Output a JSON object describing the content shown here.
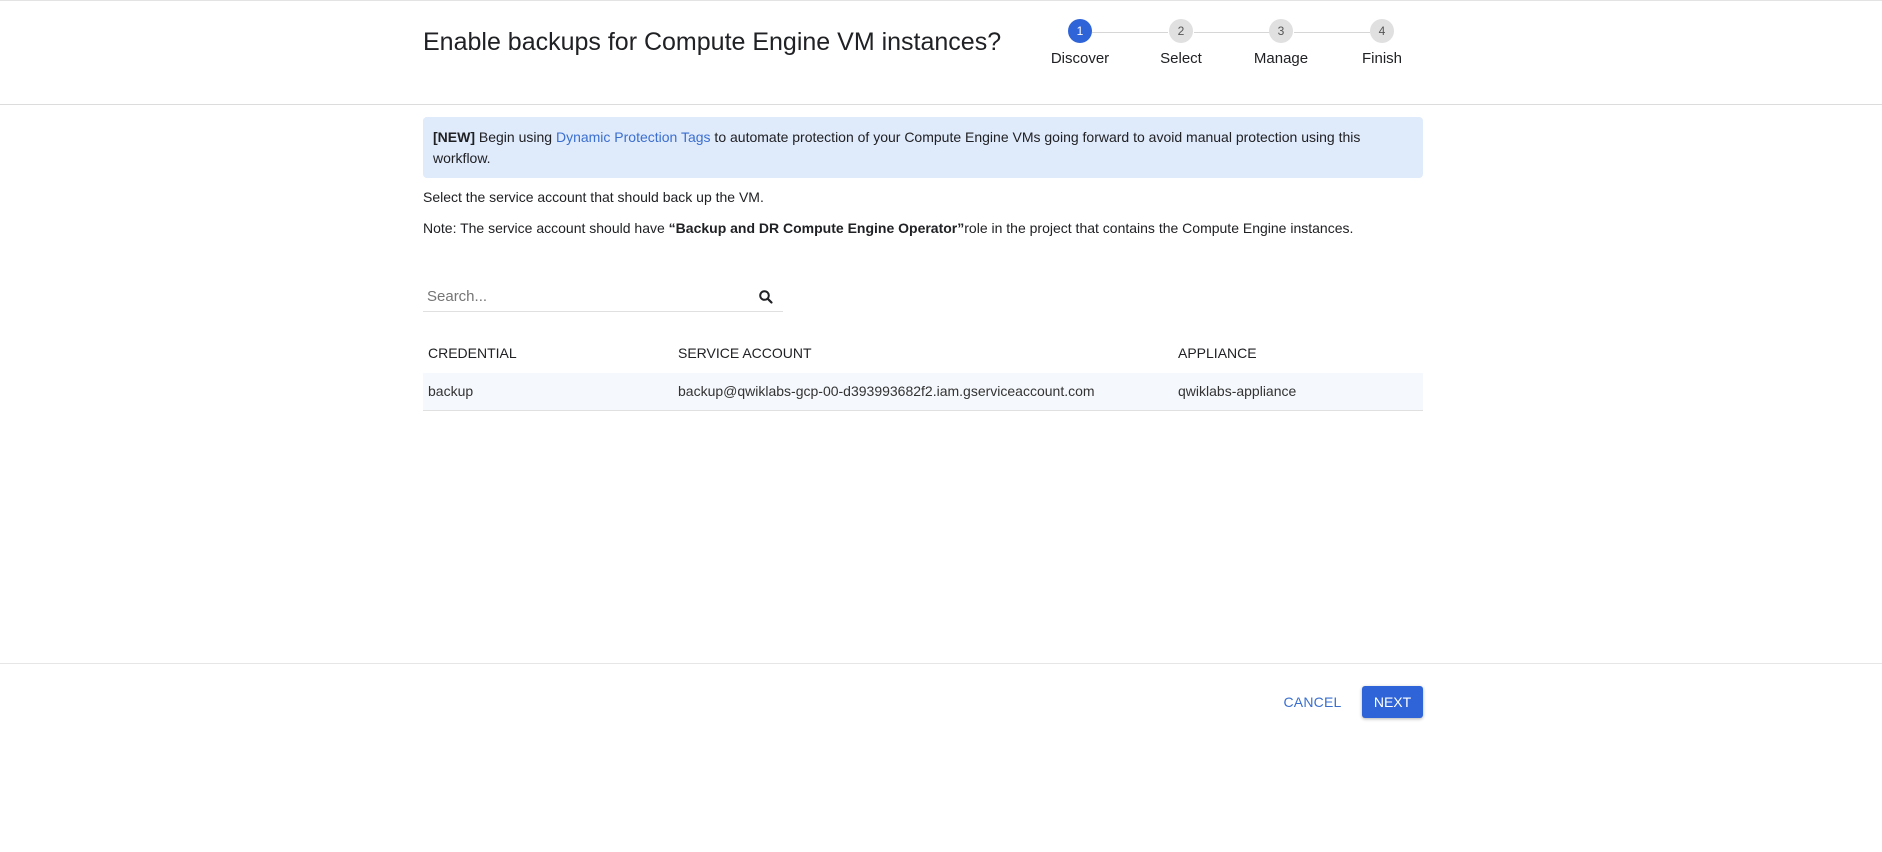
{
  "header": {
    "title": "Enable backups for Compute Engine VM instances?"
  },
  "stepper": {
    "active_step": 1,
    "steps": [
      {
        "number": "1",
        "label": "Discover"
      },
      {
        "number": "2",
        "label": "Select"
      },
      {
        "number": "3",
        "label": "Manage"
      },
      {
        "number": "4",
        "label": "Finish"
      }
    ]
  },
  "banner": {
    "tag": "[NEW]",
    "text_before": " Begin using ",
    "link": "Dynamic Protection Tags",
    "text_after": " to automate protection of your Compute Engine VMs going forward to avoid manual protection using this workflow."
  },
  "instructions": {
    "select_text": "Select the service account that should back up the VM.",
    "note_prefix": "Note: The service account should have ",
    "note_role": "“Backup and DR Compute Engine Operator”",
    "note_suffix": "role in the project that contains the Compute Engine instances."
  },
  "search": {
    "placeholder": "Search..."
  },
  "table": {
    "columns": [
      "CREDENTIAL",
      "SERVICE ACCOUNT",
      "APPLIANCE"
    ],
    "rows": [
      [
        "backup",
        "backup@qwiklabs-gcp-00-d393993682f2.iam.gserviceaccount.com",
        "qwiklabs-appliance"
      ]
    ]
  },
  "footer": {
    "cancel_label": "CANCEL",
    "next_label": "NEXT"
  },
  "colors": {
    "accent": "#2f64d8",
    "link": "#3b6fcf",
    "banner_bg": "#dfeafb"
  },
  "icons": {
    "search": "search-icon"
  }
}
